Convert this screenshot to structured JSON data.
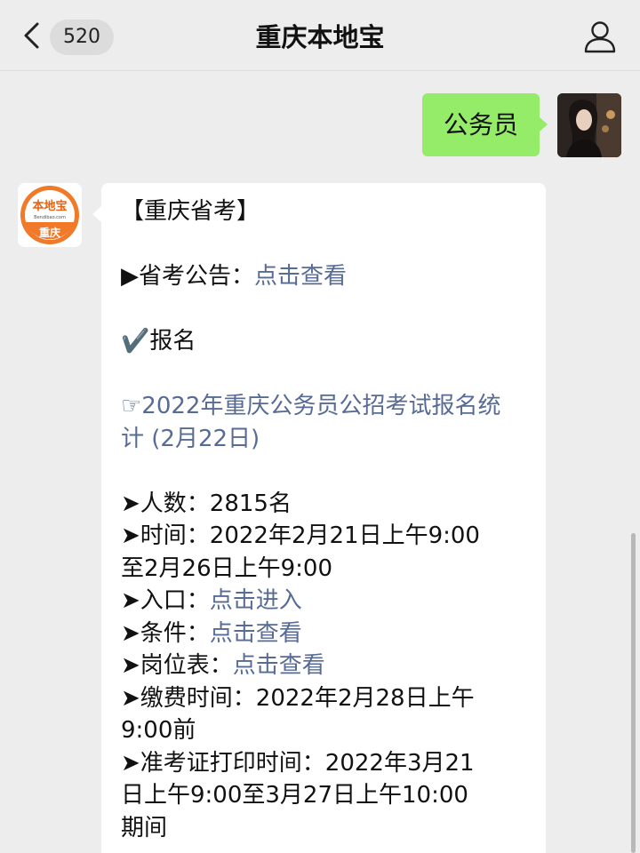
{
  "header": {
    "title": "重庆本地宝",
    "unread_count": "520",
    "back_icon": "chevron-left-icon",
    "user_icon": "person-icon"
  },
  "sent": {
    "text": "公务员"
  },
  "bot_avatar": {
    "top_text": "本地宝",
    "sub_text": "Bendibao.com",
    "city_text": "重庆"
  },
  "reply": {
    "title": "【重庆省考】",
    "notice_label": "▶省考公告：",
    "notice_link": "点击查看",
    "section": "✔️报名",
    "stats_link": "☞2022年重庆公务员公招考试报名统计 (2月22日)",
    "items": {
      "count_label": "➤人数：",
      "count_value": "2815名",
      "time_label": "➤时间：",
      "time_value_1": "2022年2月21日上午9:00",
      "time_value_2": "至2月26日上午9:00",
      "entry_label": "➤入口：",
      "entry_link": "点击进入",
      "condition_label": "➤条件：",
      "condition_link": "点击查看",
      "positions_label": "➤岗位表：",
      "positions_link": "点击查看",
      "fee_label": "➤缴费时间：",
      "fee_value_1": "2022年2月28日上午",
      "fee_value_2": "9:00前",
      "admit_label": "➤准考证打印时间：",
      "admit_value_1": "2022年3月21",
      "admit_value_2": "日上午9:00至3月27日上午10:00",
      "admit_value_3": "期间"
    }
  },
  "colors": {
    "background": "#ededed",
    "sent_bubble": "#95ec69",
    "link": "#576b95",
    "avatar_orange": "#f07a2a"
  }
}
